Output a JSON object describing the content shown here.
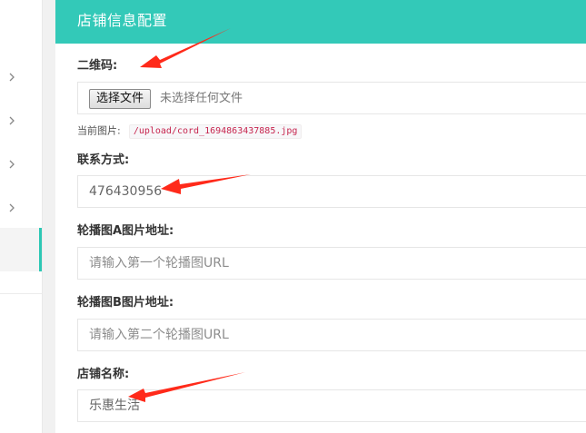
{
  "panel": {
    "title": "店铺信息配置"
  },
  "form": {
    "qrcode": {
      "label": "二维码:",
      "button": "选择文件",
      "status": "未选择任何文件",
      "current_label": "当前图片:",
      "current_path": "/upload/cord_1694863437885.jpg"
    },
    "contact": {
      "label": "联系方式:",
      "value": "476430956"
    },
    "carousel_a": {
      "label": "轮播图A图片地址:",
      "placeholder": "请输入第一个轮播图URL"
    },
    "carousel_b": {
      "label": "轮播图B图片地址:",
      "placeholder": "请输入第二个轮播图URL"
    },
    "shop_name": {
      "label": "店铺名称:",
      "value": "乐惠生活"
    }
  },
  "sidebar": {
    "chevron_icon": "chevron-right-icon",
    "active_color": "#2dc7b4"
  },
  "colors": {
    "header": "#33c9b8",
    "annotation_arrow": "#ff2a1a"
  }
}
